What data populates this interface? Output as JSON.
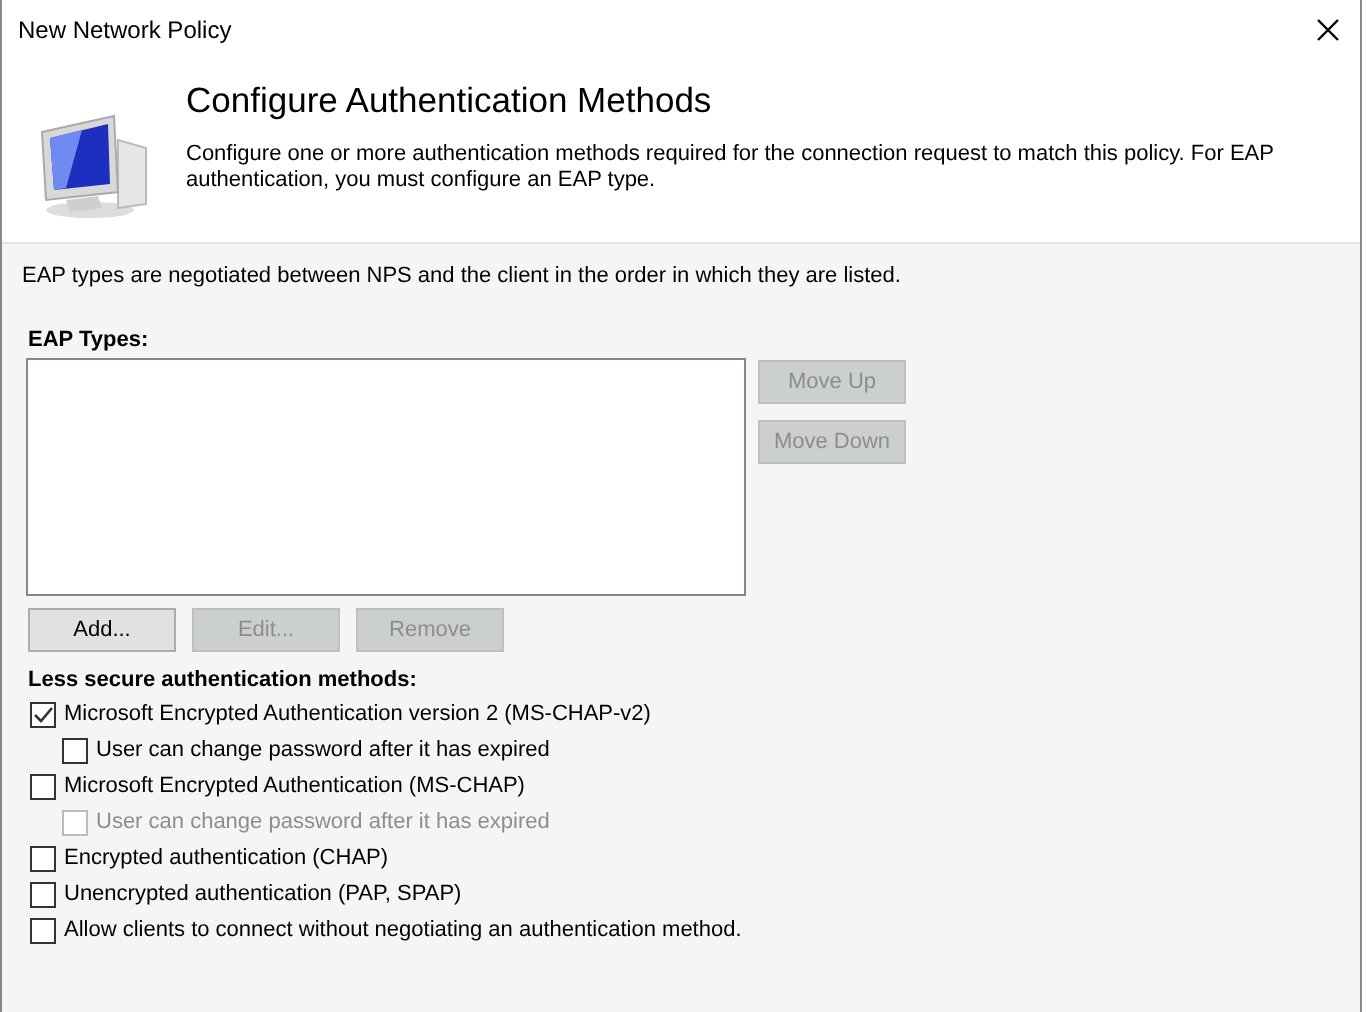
{
  "window": {
    "title": "New Network Policy"
  },
  "header": {
    "title": "Configure Authentication Methods",
    "description": "Configure one or more authentication methods required for the connection request to match this policy. For EAP authentication, you must configure an EAP type."
  },
  "intro": "EAP types are negotiated between NPS and the client in the order in which they are listed.",
  "eap_types": {
    "label": "EAP Types:"
  },
  "side_buttons": [
    {
      "label": "Move Up",
      "disabled": true
    },
    {
      "label": "Move Down",
      "disabled": true
    }
  ],
  "list_buttons": [
    {
      "label": "Add...",
      "disabled": false
    },
    {
      "label": "Edit...",
      "disabled": true
    },
    {
      "label": "Remove",
      "disabled": true
    }
  ],
  "less_secure": {
    "label": "Less secure authentication methods:",
    "options": [
      {
        "label": "Microsoft Encrypted Authentication version 2 (MS-CHAP-v2)",
        "checked": true,
        "disabled": false,
        "children": [
          {
            "label": "User can change password after it has expired",
            "checked": false,
            "disabled": false
          }
        ]
      },
      {
        "label": "Microsoft Encrypted Authentication (MS-CHAP)",
        "checked": false,
        "disabled": false,
        "children": [
          {
            "label": "User can change password after it has expired",
            "checked": false,
            "disabled": true
          }
        ]
      },
      {
        "label": "Encrypted authentication (CHAP)",
        "checked": false,
        "disabled": false
      },
      {
        "label": "Unencrypted authentication (PAP, SPAP)",
        "checked": false,
        "disabled": false
      },
      {
        "label": "Allow clients to connect without negotiating an authentication method.",
        "checked": false,
        "disabled": false
      }
    ]
  }
}
